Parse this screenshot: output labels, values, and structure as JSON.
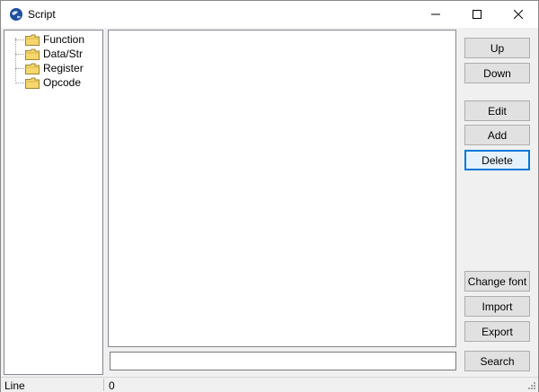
{
  "window": {
    "title": "Script"
  },
  "tree": {
    "items": [
      {
        "label": "Function"
      },
      {
        "label": "Data/Str"
      },
      {
        "label": "Register"
      },
      {
        "label": "Opcode"
      }
    ]
  },
  "editor": {
    "content": ""
  },
  "search": {
    "value": "",
    "button_label": "Search"
  },
  "buttons": {
    "up": "Up",
    "down": "Down",
    "edit": "Edit",
    "add": "Add",
    "delete": "Delete",
    "change_font": "Change font",
    "import": "Import",
    "export": "Export"
  },
  "statusbar": {
    "line_label": "Line",
    "line_value": "0"
  },
  "colors": {
    "focus_accent": "#0078d7",
    "folder_yellow": "#f5d76e"
  }
}
